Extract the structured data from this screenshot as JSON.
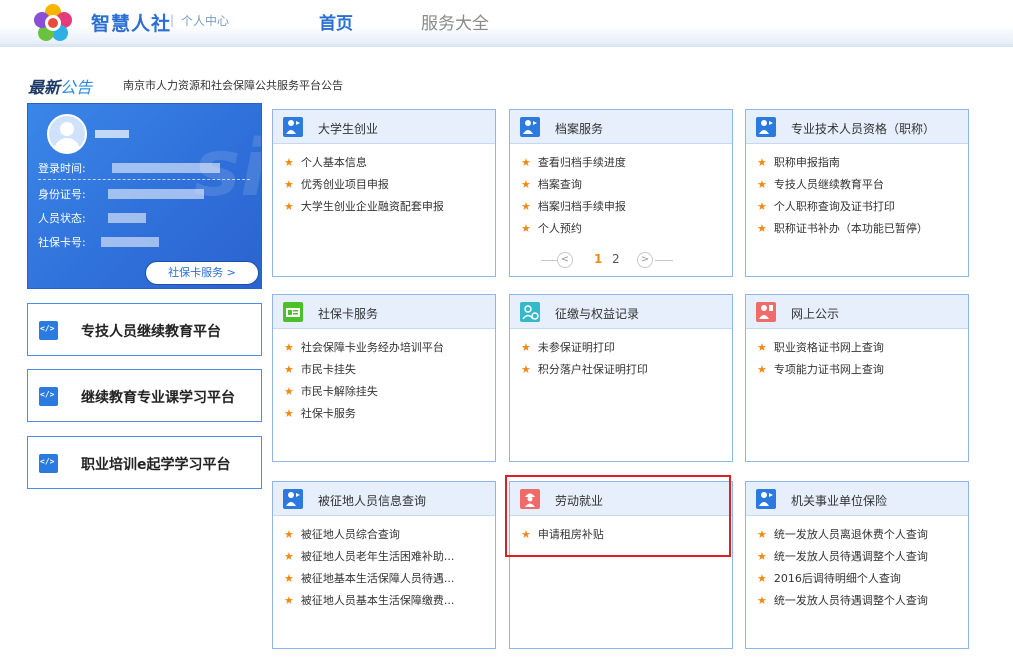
{
  "header": {
    "brand": "智慧人社",
    "separator": "|",
    "subtitle": "个人中心",
    "nav": [
      {
        "label": "首页",
        "active": true
      },
      {
        "label": "服务大全",
        "active": false
      }
    ]
  },
  "notice": {
    "label_a": "最新",
    "label_b": "公告",
    "text": "南京市人力资源和社会保障公共服务平台公告"
  },
  "user_card": {
    "fields": [
      {
        "label": "登录时间:"
      },
      {
        "label": "身份证号:"
      },
      {
        "label": "人员状态:"
      },
      {
        "label": "社保卡号:"
      }
    ],
    "button": "社保卡服务 >"
  },
  "platforms": [
    {
      "label": "专技人员继续教育平台"
    },
    {
      "label": "继续教育专业课学习平台"
    },
    {
      "label": "职业培训e起学学习平台"
    }
  ],
  "services": [
    {
      "title": "大学生创业",
      "icon": "person-flag-icon",
      "color": "#2a7ae0",
      "items": [
        "个人基本信息",
        "优秀创业项目申报",
        "大学生创业企业融资配套申报"
      ]
    },
    {
      "title": "档案服务",
      "icon": "person-flag-icon",
      "color": "#2a7ae0",
      "items": [
        "查看归档手续进度",
        "档案查询",
        "档案归档手续申报",
        "个人预约"
      ],
      "pager": {
        "prev": "<",
        "page1": "1",
        "page2": "2",
        "next": ">"
      }
    },
    {
      "title": "专业技术人员资格（职称）",
      "icon": "person-flag-icon",
      "color": "#2a7ae0",
      "items": [
        "职称申报指南",
        "专技人员继续教育平台",
        "个人职称查询及证书打印",
        "职称证书补办（本功能已暂停）"
      ]
    },
    {
      "title": "社保卡服务",
      "icon": "id-card-icon",
      "color": "#4cbf2a",
      "items": [
        "社会保障卡业务经办培训平台",
        "市民卡挂失",
        "市民卡解除挂失",
        "社保卡服务"
      ]
    },
    {
      "title": "征缴与权益记录",
      "icon": "person-record-icon",
      "color": "#35b8c9",
      "items": [
        "未参保证明打印",
        "积分落户社保证明打印"
      ]
    },
    {
      "title": "网上公示",
      "icon": "person-badge-icon",
      "color": "#f06a6a",
      "items": [
        "职业资格证书网上查询",
        "专项能力证书网上查询"
      ]
    },
    {
      "title": "被征地人员信息查询",
      "icon": "person-flag-icon",
      "color": "#2a7ae0",
      "items": [
        "被征地人员综合查询",
        "被征地人员老年生活困难补助...",
        "被征地基本生活保障人员待遇...",
        "被征地人员基本生活保障缴费..."
      ]
    },
    {
      "title": "劳动就业",
      "icon": "worker-icon",
      "color": "#f06a6a",
      "items": [
        "申请租房补贴"
      ]
    },
    {
      "title": "机关事业单位保险",
      "icon": "person-flag-icon",
      "color": "#2a7ae0",
      "items": [
        "统一发放人员离退休费个人查询",
        "统一发放人员待遇调整个人查询",
        "2016后调待明细个人查询",
        "统一发放人员待遇调整个人查询"
      ]
    }
  ],
  "colors": {
    "brand": "#2a6fd6",
    "star": "#f08a17",
    "highlight": "#e02020"
  }
}
